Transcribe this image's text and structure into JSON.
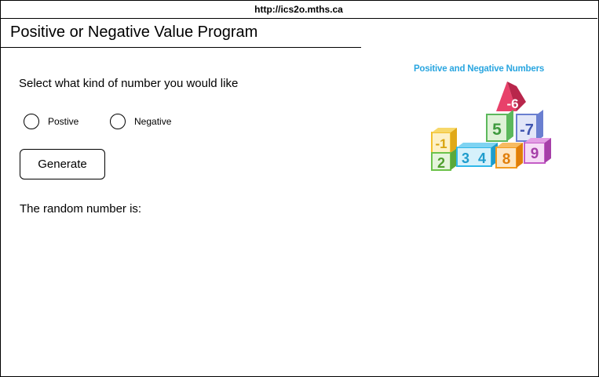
{
  "browser": {
    "url": "http://ics2o.mths.ca"
  },
  "header": {
    "title": "Positive or Negative Value Program"
  },
  "form": {
    "prompt": "Select what kind of number you would like",
    "options": [
      "Postive",
      "Negative"
    ],
    "generate_label": "Generate",
    "result_label": "The random number is:"
  },
  "illustration": {
    "title": "Positive and Negative Numbers",
    "blocks": [
      "-6",
      "5",
      "-7",
      "-1",
      "2",
      "3",
      "4",
      "8",
      "9"
    ],
    "colors": {
      "title": "#2aa6e0",
      "pink": "#e8416a",
      "green": "#5cb85c",
      "blue": "#6a7fd0",
      "yellow": "#f2c12e",
      "cyan": "#2fb7e8",
      "orange": "#f39a1e",
      "violet": "#c45cc6"
    }
  }
}
